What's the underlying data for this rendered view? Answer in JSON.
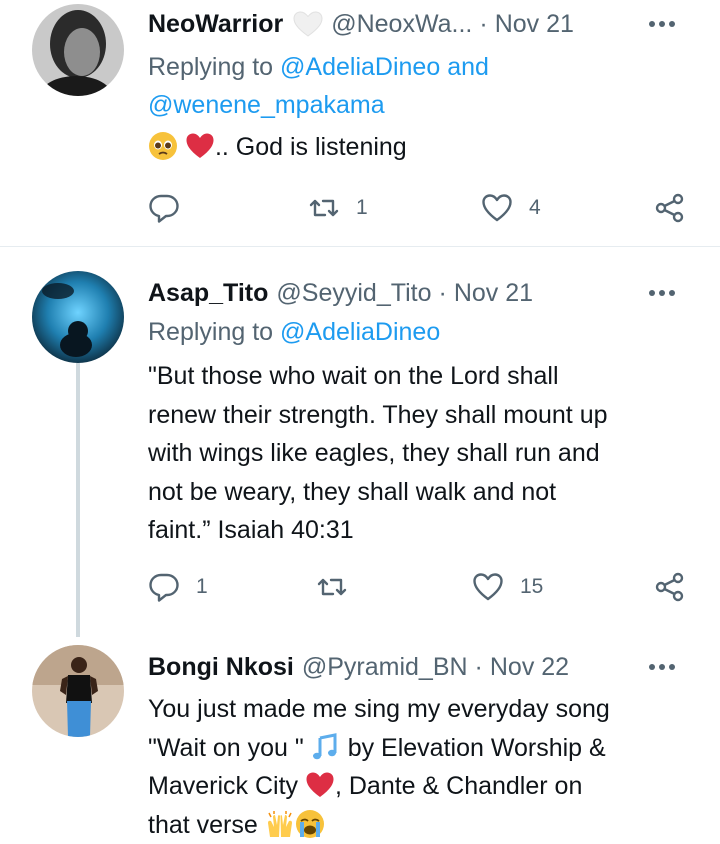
{
  "tweets": [
    {
      "name": "NeoWarrior",
      "handle": "@NeoxWa...",
      "date": "Nov 21",
      "reply_prefix": "Replying to",
      "reply_users": [
        "@AdeliaDineo",
        "@wenene_mpakama"
      ],
      "reply_joiner": "and",
      "text": ".. God is listening",
      "emojis": [
        "pleading-face",
        "red-heart"
      ],
      "actions": {
        "reply": "",
        "retweet": "1",
        "like": "4"
      }
    },
    {
      "name": "Asap_Tito",
      "handle": "@Seyyid_Tito",
      "date": "Nov 21",
      "reply_prefix": "Replying to",
      "reply_users": [
        "@AdeliaDineo"
      ],
      "text_lines": [
        "\"But those who wait on the Lord shall",
        "renew their strength. They shall mount up",
        "with wings like eagles, they shall run and",
        "not be weary, they shall walk and not",
        "faint.” Isaiah 40:31"
      ],
      "actions": {
        "reply": "1",
        "retweet": "",
        "like": "15"
      }
    },
    {
      "name": "Bongi Nkosi",
      "handle": "@Pyramid_BN",
      "date": "Nov 22",
      "text_line1": "You just made me sing my everyday song",
      "text_line2_a": "\"Wait on you \"",
      "text_line2_b": "by Elevation Worship &",
      "text_line3_a": "Maverick City",
      "text_line3_b": ", Dante & Chandler on",
      "text_line4": "that verse",
      "emojis": [
        "musical-notes",
        "red-heart",
        "raising-hands",
        "loudly-crying-face"
      ]
    }
  ],
  "separator": "·",
  "colors": {
    "text": "#0f1419",
    "secondary": "#536471",
    "link": "#1d9bf0",
    "divider": "#e6ecf0",
    "heart": "#e0245e"
  }
}
